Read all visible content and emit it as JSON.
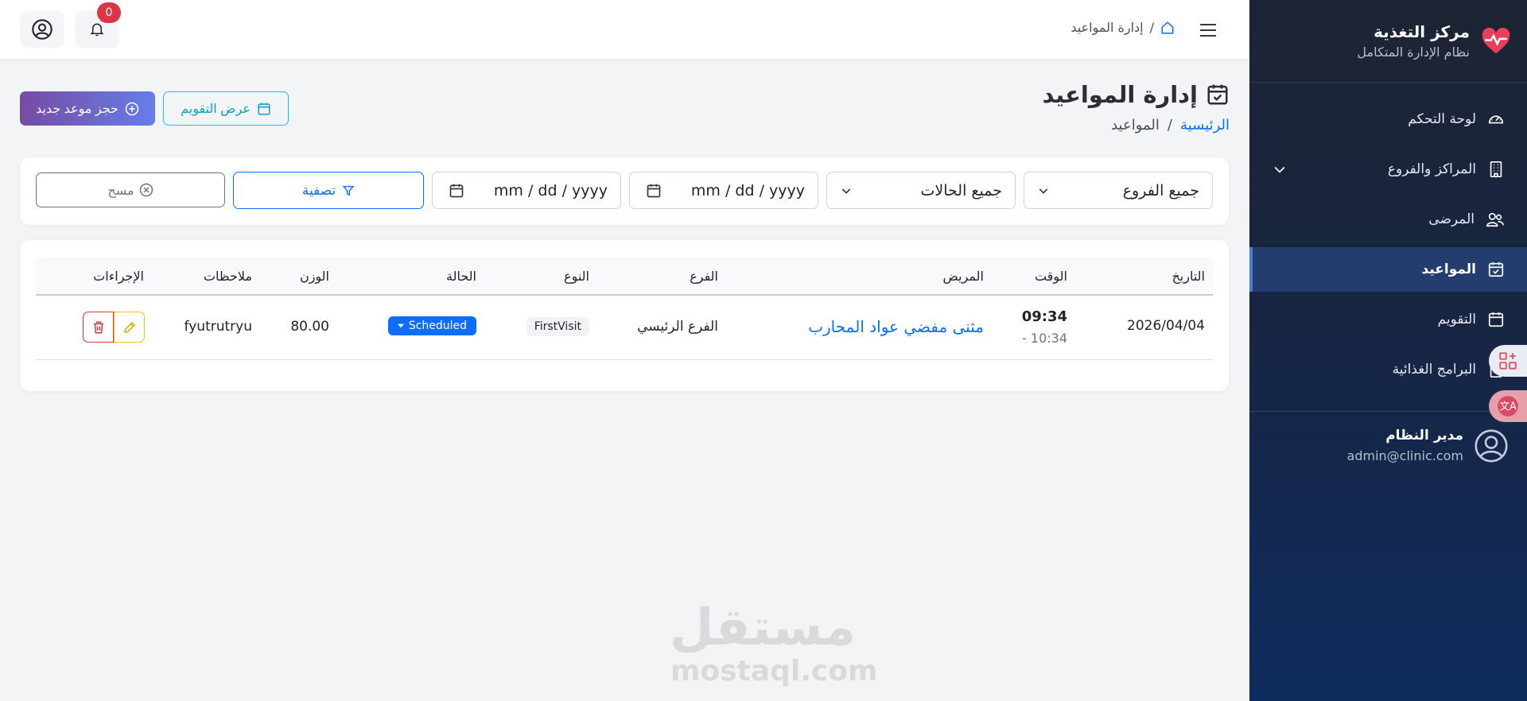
{
  "brand": {
    "title": "مركز التغذية",
    "subtitle": "نظام الإدارة المتكامل"
  },
  "sidebar": {
    "items": [
      {
        "label": "لوحة التحكم",
        "icon": "speedometer-icon"
      },
      {
        "label": "المراكز والفروع",
        "icon": "building-icon"
      },
      {
        "label": "المرضى",
        "icon": "people-icon"
      },
      {
        "label": "المواعيد",
        "icon": "calendar-check-icon",
        "active": true
      },
      {
        "label": "التقويم",
        "icon": "calendar-icon"
      },
      {
        "label": "البرامج الغذائية",
        "icon": "clipboard-icon"
      }
    ]
  },
  "user": {
    "name": "مدير النظام",
    "email": "admin@clinic.com"
  },
  "header": {
    "breadcrumb": "إدارة المواعيد",
    "notifications_count": "0"
  },
  "page": {
    "title": "إدارة المواعيد",
    "breadcrumb_home": "الرئيسية",
    "breadcrumb_sep": "/",
    "breadcrumb_current": "المواعيد",
    "new_button": "حجز موعد جديد",
    "calendar_button": "عرض التقويم"
  },
  "filters": {
    "branch": "جميع الفروع",
    "status": "جميع الحالات",
    "date_from": "mm / dd / yyyy",
    "date_to": "mm / dd / yyyy",
    "filter_button": "تصفية",
    "clear_button": "مسح"
  },
  "table": {
    "headers": {
      "date": "التاريخ",
      "time": "الوقت",
      "patient": "المريض",
      "branch": "الفرع",
      "type": "النوع",
      "status": "الحالة",
      "weight": "الوزن",
      "notes": "ملاحظات",
      "actions": "الإجراءات"
    },
    "rows": [
      {
        "date": "2026/04/04",
        "time_start": "09:34",
        "time_end": "- 10:34",
        "patient": "مثنى مفضي عواد المحارب",
        "branch": "الفرع الرئيسي",
        "type": "FirstVisit",
        "status": "Scheduled",
        "weight": "80.00",
        "notes": "fyutrutryu"
      }
    ]
  },
  "watermark": {
    "arabic": "مستقل",
    "latin": "mostaql.com"
  },
  "colors": {
    "primary": "#0d6efd",
    "sidebar_top": "#1d2433",
    "sidebar_bottom": "#0f2c5e",
    "danger": "#dc3545",
    "warning": "#ffc107",
    "info": "#0dcaf0"
  }
}
